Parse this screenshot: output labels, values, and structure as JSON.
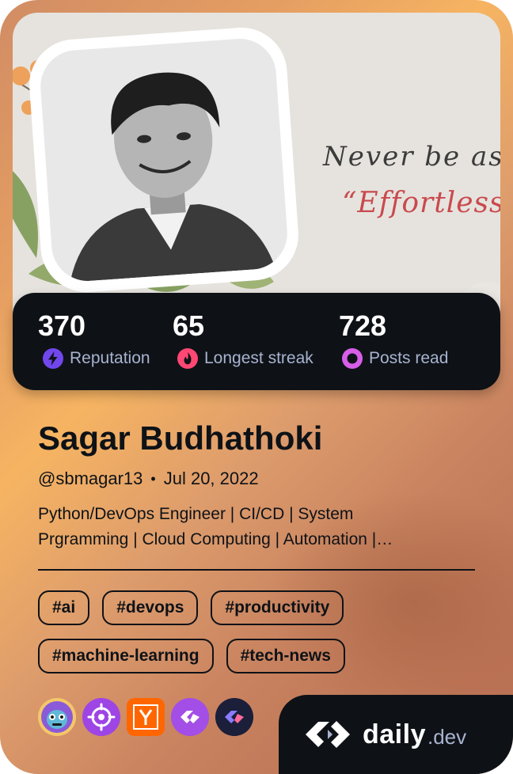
{
  "cover": {
    "quote_line1": "Never be asha",
    "quote_line2": "“Effortlessne."
  },
  "stats": [
    {
      "value": "370",
      "label": "Reputation",
      "icon": "lightning-icon",
      "color": "#7147ed"
    },
    {
      "value": "65",
      "label": "Longest streak",
      "icon": "flame-icon",
      "color": "#ff4773"
    },
    {
      "value": "728",
      "label": "Posts read",
      "icon": "eye-ring-icon",
      "color": "#d65ee8"
    }
  ],
  "profile": {
    "name": "Sagar Budhathoki",
    "handle": "@sbmagar13",
    "separator": "•",
    "joined": "Jul 20, 2022",
    "bio_line1": "Python/DevOps Engineer | CI/CD | System",
    "bio_line2": "Prgramming | Cloud Computing | Automation |…"
  },
  "tags": [
    "#ai",
    "#devops",
    "#productivity",
    "#machine-learning",
    "#tech-news"
  ],
  "squads": [
    {
      "icon": "robot-squad-icon",
      "color": "#7b4bd8"
    },
    {
      "icon": "crosshair-squad-icon",
      "color": "#9e45e5"
    },
    {
      "icon": "y-combinator-icon",
      "letter": "Y",
      "color": "#ff6600"
    },
    {
      "icon": "daily-purple-squad-icon",
      "color": "#a34ee6"
    },
    {
      "icon": "daily-dark-squad-icon",
      "color": "#1b1f3a"
    }
  ],
  "brand": {
    "daily": "daily",
    "dev": ".dev"
  },
  "colors": {
    "card_dark": "#0e1217",
    "label_gray": "#a8b3cf",
    "accent_bronze": "#e59e62"
  }
}
